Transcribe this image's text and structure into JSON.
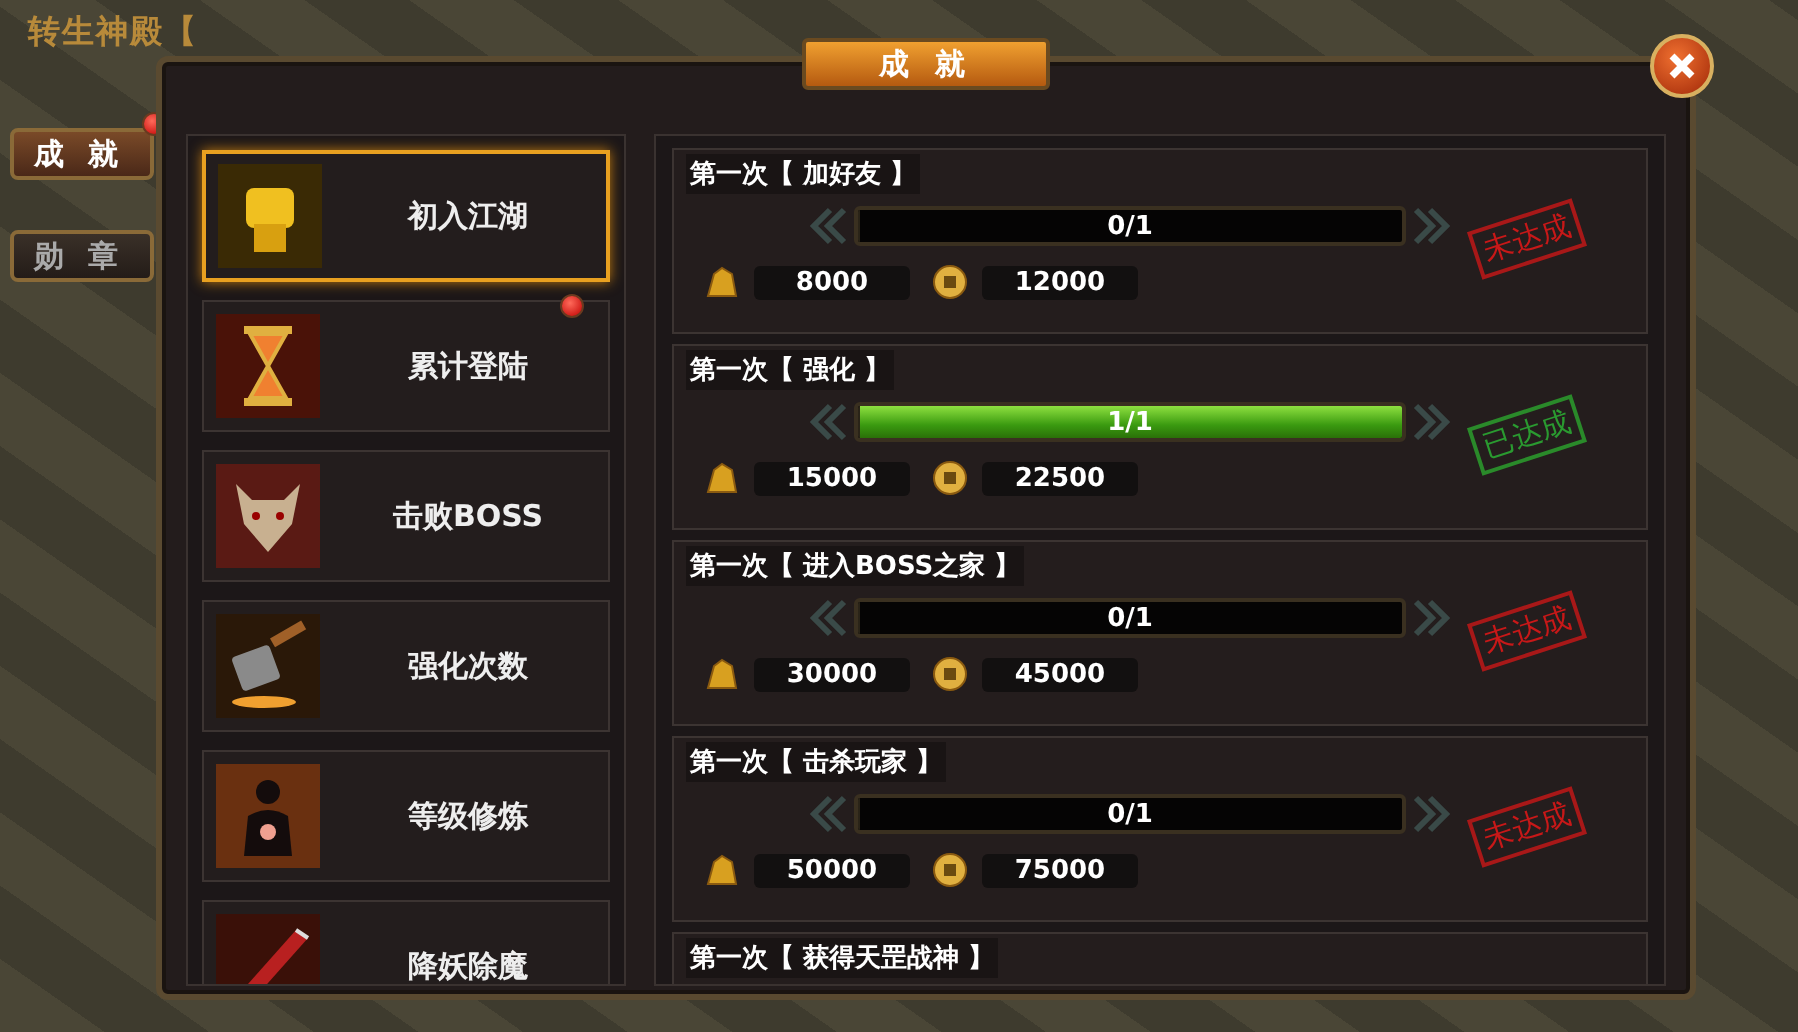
{
  "background_labels": [
    {
      "text": "转生神殿【"
    }
  ],
  "dialog": {
    "title": "成 就"
  },
  "side_tabs": [
    {
      "label": "成 就",
      "selected": true,
      "badge": true
    },
    {
      "label": "勋 章",
      "selected": false,
      "badge": false
    }
  ],
  "categories": [
    {
      "label": "初入江湖",
      "selected": true,
      "badge": false
    },
    {
      "label": "累计登陆",
      "selected": false,
      "badge": true
    },
    {
      "label": "击败BOSS",
      "selected": false,
      "badge": false
    },
    {
      "label": "强化次数",
      "selected": false,
      "badge": false
    },
    {
      "label": "等级修炼",
      "selected": false,
      "badge": false
    },
    {
      "label": "降妖除魔",
      "selected": false,
      "badge": false
    }
  ],
  "achievements": [
    {
      "title": "第一次【 加好友 】",
      "progress": "0/1",
      "level": 0,
      "achieved": false,
      "stamp": "未达成",
      "gold": "8000",
      "coin": "12000"
    },
    {
      "title": "第一次【 强化 】",
      "progress": "1/1",
      "level": 1,
      "achieved": true,
      "stamp": "已达成",
      "gold": "15000",
      "coin": "22500"
    },
    {
      "title": "第一次【 进入BOSS之家 】",
      "progress": "0/1",
      "level": 0,
      "achieved": false,
      "stamp": "未达成",
      "gold": "30000",
      "coin": "45000"
    },
    {
      "title": "第一次【 击杀玩家 】",
      "progress": "0/1",
      "level": 0,
      "achieved": false,
      "stamp": "未达成",
      "gold": "50000",
      "coin": "75000"
    },
    {
      "title": "第一次【 获得天罡战神 】"
    }
  ]
}
